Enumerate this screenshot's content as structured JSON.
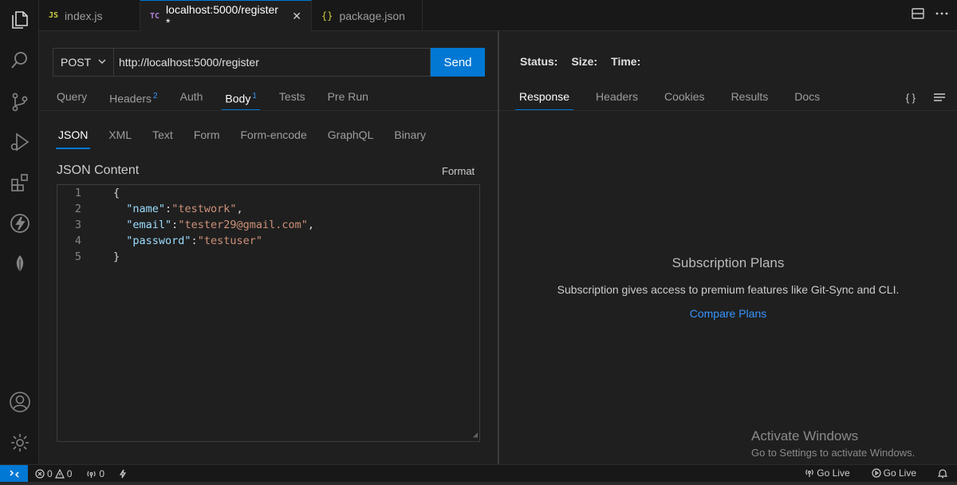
{
  "tabs": [
    {
      "badge": "JS",
      "label": "index.js"
    },
    {
      "badge": "TC",
      "label": "localhost:5000/register *",
      "close": "✕"
    },
    {
      "badge": "{}",
      "label": "package.json"
    }
  ],
  "request": {
    "method": "POST",
    "url": "http://localhost:5000/register",
    "send_label": "Send",
    "tabs": [
      {
        "label": "Query",
        "count": ""
      },
      {
        "label": "Headers",
        "count": "2"
      },
      {
        "label": "Auth",
        "count": ""
      },
      {
        "label": "Body",
        "count": "1"
      },
      {
        "label": "Tests",
        "count": ""
      },
      {
        "label": "Pre Run",
        "count": ""
      }
    ],
    "active_tab": "Body"
  },
  "body": {
    "tabs": [
      "JSON",
      "XML",
      "Text",
      "Form",
      "Form-encode",
      "GraphQL",
      "Binary"
    ],
    "active_tab": "JSON",
    "content_title": "JSON Content",
    "format_label": "Format",
    "lines": [
      {
        "num": "1",
        "text": "{"
      },
      {
        "num": "2",
        "key": "\"name\"",
        "value": "\"testwork\"",
        "trail": ","
      },
      {
        "num": "3",
        "key": "\"email\"",
        "value": "\"tester29@gmail.com\"",
        "trail": ","
      },
      {
        "num": "4",
        "key": "\"password\"",
        "value": "\"testuser\"",
        "trail": ""
      },
      {
        "num": "5",
        "text": "}"
      }
    ]
  },
  "response": {
    "status_label": "Status:",
    "size_label": "Size:",
    "time_label": "Time:",
    "tabs": [
      "Response",
      "Headers",
      "Cookies",
      "Results",
      "Docs"
    ],
    "active_tab": "Response",
    "braces_label": "{ }",
    "subscription_title": "Subscription Plans",
    "subscription_desc": "Subscription gives access to premium features like Git-Sync and CLI.",
    "compare_link": "Compare Plans"
  },
  "watermark": {
    "title": "Activate Windows",
    "subtitle": "Go to Settings to activate Windows."
  },
  "statusbar": {
    "errors": "0",
    "warnings": "0",
    "ports": "0",
    "go_live_1": "Go Live",
    "go_live_2": "Go Live"
  },
  "colors": {
    "accent": "#0078d4",
    "link": "#3794ff",
    "json_key": "#9cdcfe",
    "json_string": "#ce9178"
  }
}
